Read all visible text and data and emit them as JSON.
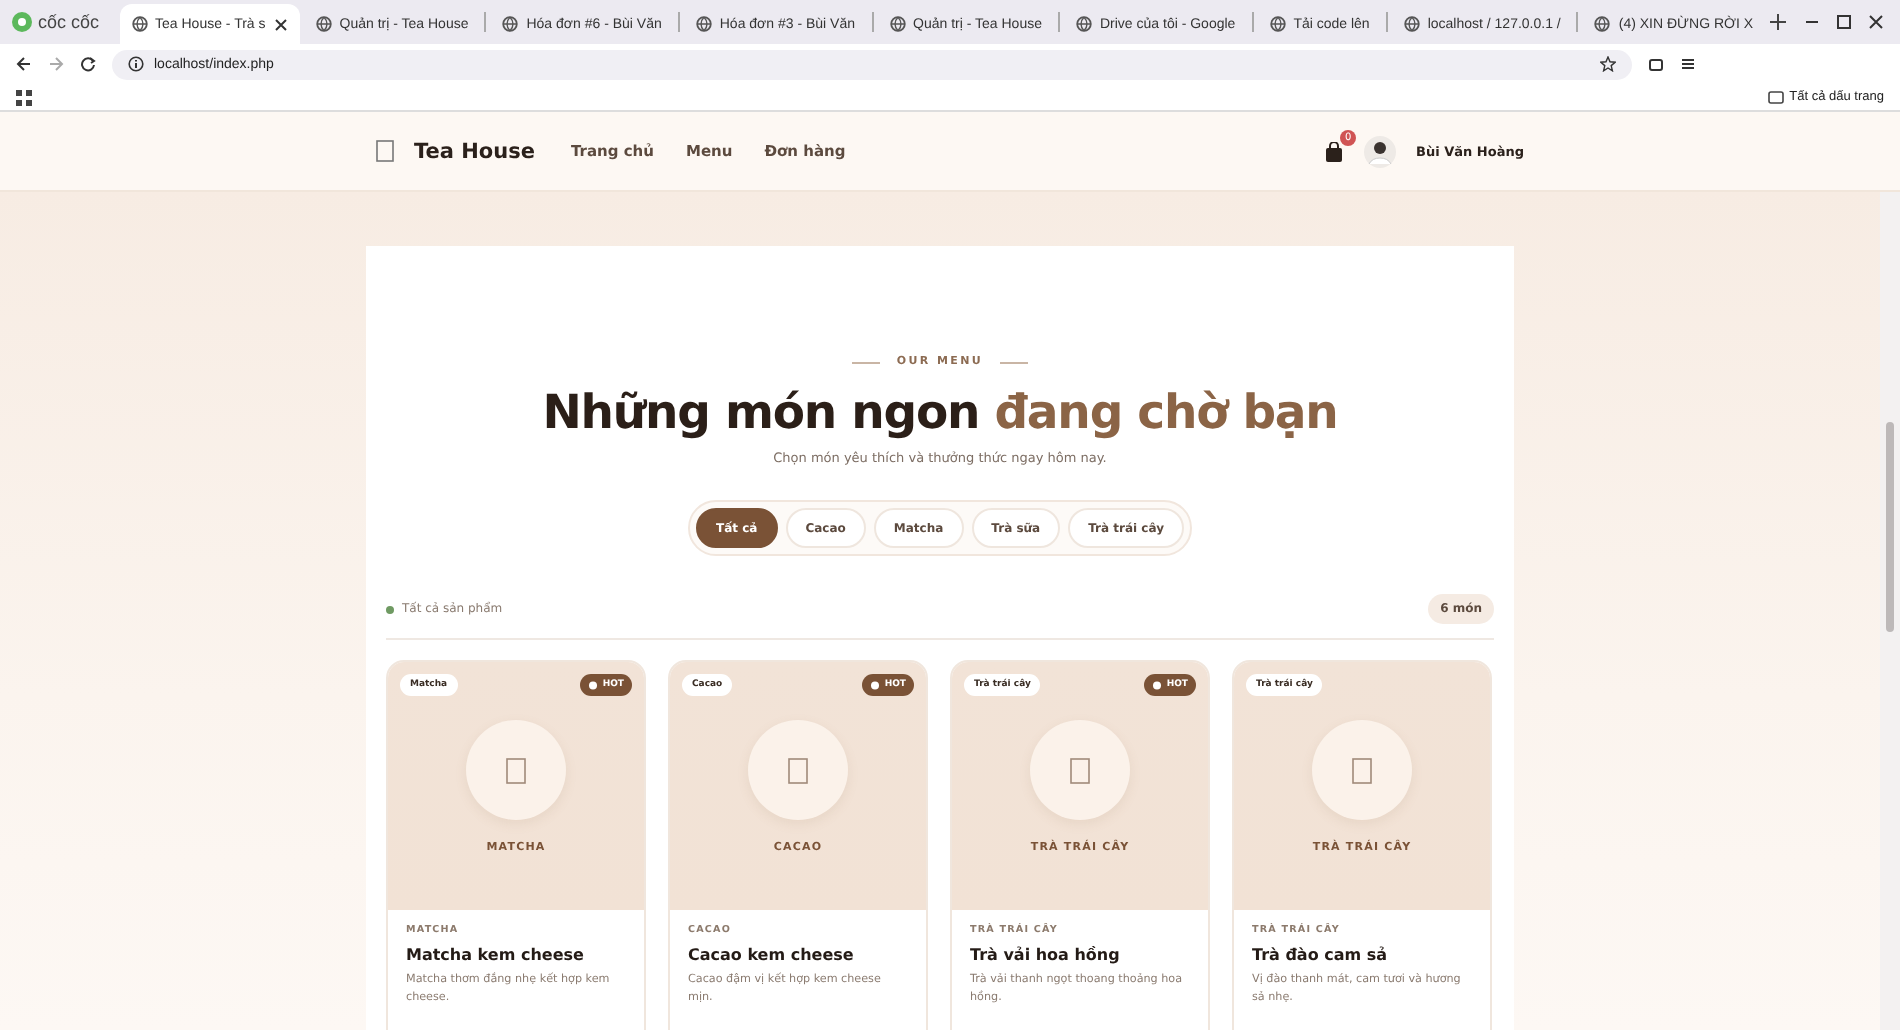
{
  "browser": {
    "brand": "cốc cốc",
    "tabs": [
      {
        "title": "Tea House - Trà s",
        "selected": true
      },
      {
        "title": "Quản trị - Tea House",
        "selected": false
      },
      {
        "title": "Hóa đơn #6 - Bùi Văn",
        "selected": false
      },
      {
        "title": "Hóa đơn #3 - Bùi Văn",
        "selected": false
      },
      {
        "title": "Quản trị - Tea House",
        "selected": false
      },
      {
        "title": "Drive của tôi - Google",
        "selected": false
      },
      {
        "title": "Tải code lên",
        "selected": false
      },
      {
        "title": "localhost / 127.0.0.1 /",
        "selected": false
      },
      {
        "title": "(4) XIN ĐỪNG RỜI X",
        "selected": false
      }
    ],
    "address": "localhost/index.php",
    "bookmarks": "Tất cả dấu trang"
  },
  "header": {
    "logo": "Tea House",
    "nav": [
      "Trang chủ",
      "Menu",
      "Đơn hàng"
    ],
    "cart_count": "0",
    "user": "Bùi Văn Hoàng"
  },
  "hero": {
    "eyebrow": "OUR MENU",
    "title": "Những món ngon",
    "title_accent": "đang chờ bạn",
    "subtitle": "Chọn món yêu thích và thưởng thức ngay hôm nay.",
    "filters": [
      {
        "label": "Tất cả",
        "selected": true
      },
      {
        "label": "Cacao",
        "selected": false
      },
      {
        "label": "Matcha",
        "selected": false
      },
      {
        "label": "Trà sữa",
        "selected": false
      },
      {
        "label": "Trà trái cây",
        "selected": false
      }
    ],
    "result_label": "Tất cả sản phẩm",
    "count": "6 món"
  },
  "products": [
    {
      "tag": "Matcha",
      "badge": "HOT",
      "image_label": "MATCHA",
      "category": "MATCHA",
      "name": "Matcha kem cheese",
      "description": "Matcha thơm đắng nhẹ kết hợp kem cheese."
    },
    {
      "tag": "Cacao",
      "badge": "HOT",
      "image_label": "CACAO",
      "category": "CACAO",
      "name": "Cacao kem cheese",
      "description": "Cacao đậm vị kết hợp kem cheese mịn."
    },
    {
      "tag": "Trà trái cây",
      "badge": "HOT",
      "image_label": "TRÀ TRÁI CÂY",
      "category": "TRÀ TRÁI CÂY",
      "name": "Trà vải hoa hồng",
      "description": "Trà vải thanh ngọt thoang thoảng hoa hồng."
    },
    {
      "tag": "Trà trái cây",
      "image_label": "TRÀ TRÁI CÂY",
      "category": "TRÀ TRÁI CÂY",
      "name": "Trà đào cam sả",
      "description": "Vị đào thanh mát, cam tươi và hương sả nhẹ."
    }
  ]
}
